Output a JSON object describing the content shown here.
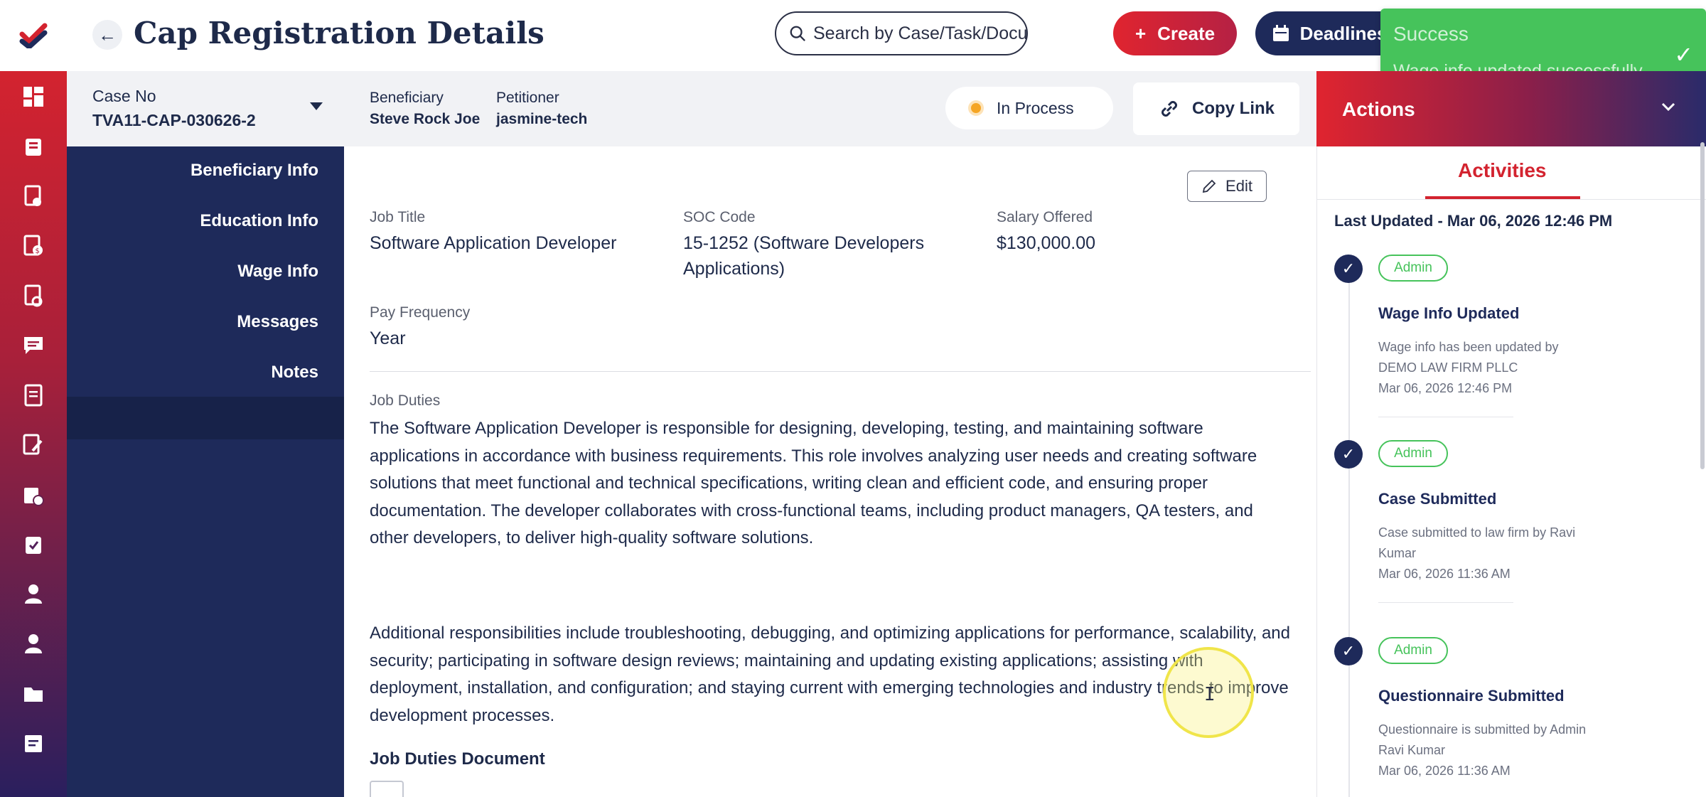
{
  "header": {
    "title": "Cap Registration Details",
    "search_placeholder": "Search by Case/Task/Document",
    "create_label": "Create",
    "deadlines_label": "Deadlines"
  },
  "toast": {
    "title": "Success",
    "message": "Wage info updated successfully."
  },
  "case_bar": {
    "case_no_label": "Case No",
    "case_no": "TVA11-CAP-030626-2",
    "beneficiary_label": "Beneficiary",
    "beneficiary": "Steve Rock Joe",
    "petitioner_label": "Petitioner",
    "petitioner": "jasmine-tech",
    "status": "In Process",
    "copy_link_label": "Copy Link",
    "status_color": "#f5a524"
  },
  "actions": {
    "title": "Actions"
  },
  "subnav": {
    "items": [
      {
        "label": "Beneficiary Info"
      },
      {
        "label": "Education Info"
      },
      {
        "label": "Wage Info"
      },
      {
        "label": "Messages"
      },
      {
        "label": "Notes"
      }
    ],
    "active": "Wage Info"
  },
  "wage_info": {
    "edit_label": "Edit",
    "job_title_label": "Job Title",
    "job_title": "Software Application Developer",
    "soc_code_label": "SOC Code",
    "soc_code_line1": "15-1252 (Software Developers",
    "soc_code_line2": "Applications)",
    "salary_label": "Salary Offered",
    "salary": "$130,000.00",
    "pay_frequency_label": "Pay Frequency",
    "pay_frequency": "Year",
    "job_duties_label": "Job Duties",
    "job_duties_p1": "The Software Application Developer is responsible for designing, developing, testing, and maintaining software applications in accordance with business requirements. This role involves analyzing user needs and creating software solutions that meet functional and technical specifications, writing clean and efficient code, and ensuring proper documentation. The developer collaborates with cross-functional teams, including product managers, QA testers, and other developers, to deliver high-quality software solutions.",
    "job_duties_p2": "Additional responsibilities include troubleshooting, debugging, and optimizing applications for performance, scalability, and security; participating in software design reviews; maintaining and updating existing applications; assisting with deployment, installation, and configuration; and staying current with emerging technologies and industry trends to improve development processes.",
    "job_duties_document_label": "Job Duties Document"
  },
  "activities": {
    "tab_label": "Activities",
    "last_updated": "Last Updated - Mar 06, 2026 12:46 PM",
    "items": [
      {
        "badge": "Admin",
        "title": "Wage Info Updated",
        "desc_line1": "Wage info has been updated by",
        "desc_line2": "DEMO LAW FIRM PLLC",
        "time": "Mar 06, 2026 12:46 PM"
      },
      {
        "badge": "Admin",
        "title": "Case Submitted",
        "desc_line1": "Case submitted to law firm by Ravi",
        "desc_line2": "Kumar",
        "time": "Mar 06, 2026 11:36 AM"
      },
      {
        "badge": "Admin",
        "title": "Questionnaire Submitted",
        "desc_line1": "Questionnaire is submitted by Admin",
        "desc_line2": "Ravi Kumar",
        "time": "Mar 06, 2026 11:36 AM"
      }
    ]
  },
  "colors": {
    "brand_red": "#d3232f",
    "navy": "#1e2a5a",
    "success_green": "#46c35b"
  }
}
